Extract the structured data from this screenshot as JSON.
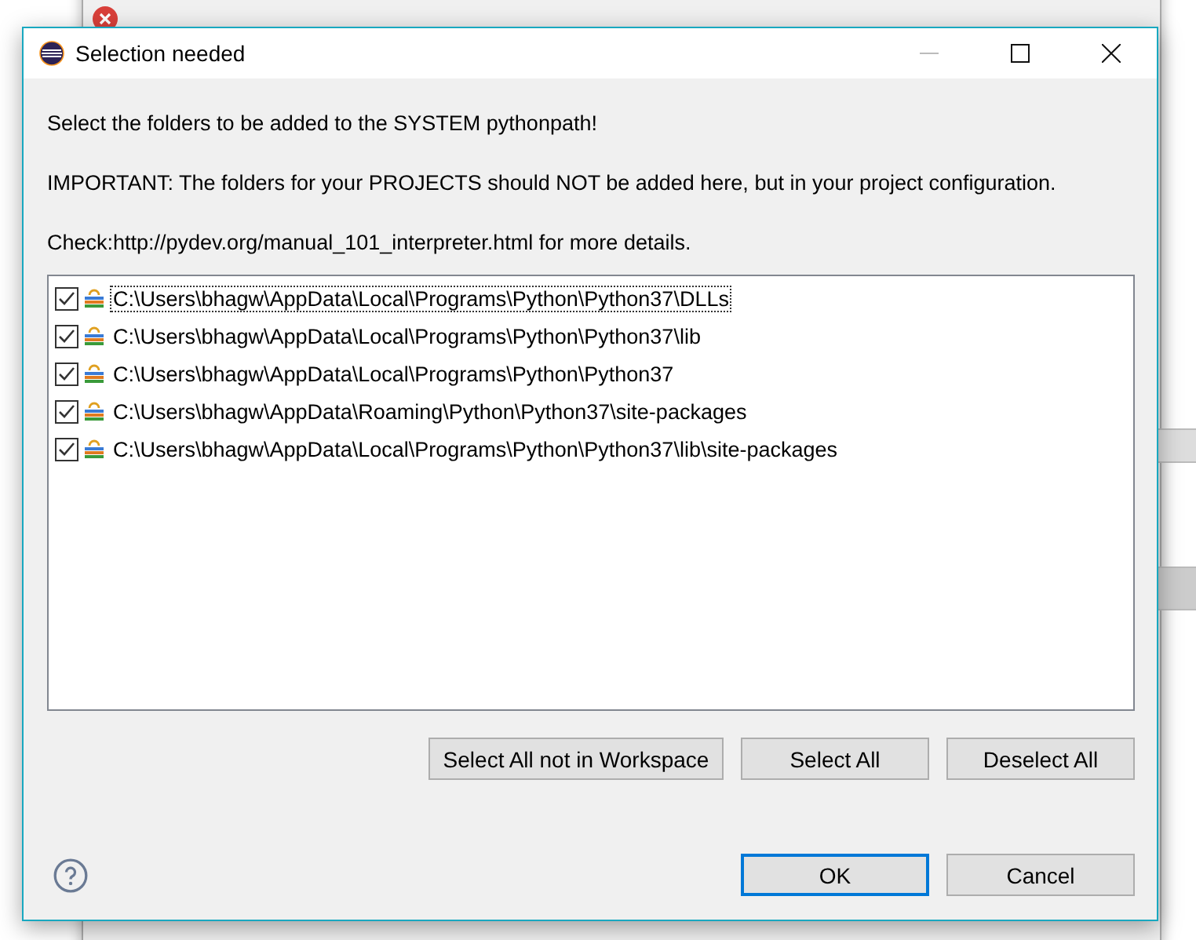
{
  "window": {
    "title": "Selection needed"
  },
  "messages": [
    "Select the folders to be added to the SYSTEM pythonpath!",
    "IMPORTANT: The folders for your PROJECTS should NOT be added here, but in your project configuration.",
    "Check:http://pydev.org/manual_101_interpreter.html for more details."
  ],
  "folders": [
    {
      "path": "C:\\Users\\bhagw\\AppData\\Local\\Programs\\Python\\Python37\\DLLs",
      "checked": true,
      "selected": true
    },
    {
      "path": "C:\\Users\\bhagw\\AppData\\Local\\Programs\\Python\\Python37\\lib",
      "checked": true,
      "selected": false
    },
    {
      "path": "C:\\Users\\bhagw\\AppData\\Local\\Programs\\Python\\Python37",
      "checked": true,
      "selected": false
    },
    {
      "path": "C:\\Users\\bhagw\\AppData\\Roaming\\Python\\Python37\\site-packages",
      "checked": true,
      "selected": false
    },
    {
      "path": "C:\\Users\\bhagw\\AppData\\Local\\Programs\\Python\\Python37\\lib\\site-packages",
      "checked": true,
      "selected": false
    }
  ],
  "selection_buttons": [
    "Select All not in Workspace",
    "Select All",
    "Deselect All"
  ],
  "buttons": [
    {
      "label": "OK",
      "default": true
    },
    {
      "label": "Cancel",
      "default": false
    }
  ]
}
